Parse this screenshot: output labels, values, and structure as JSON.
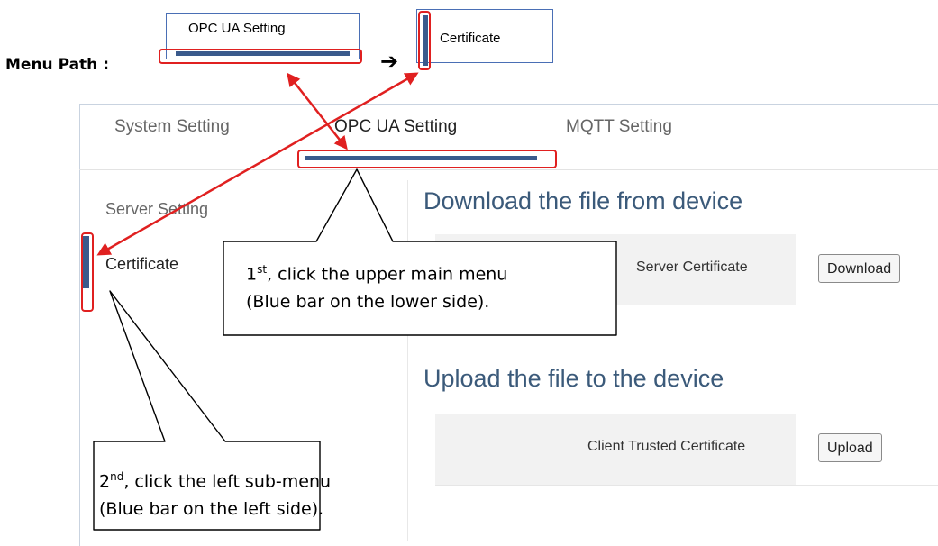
{
  "menu_path": {
    "label": "Menu Path :",
    "step1_label": "OPC UA Setting",
    "arrow": "➔",
    "step2_label": "Certificate"
  },
  "top_nav": {
    "tabs": [
      {
        "label": "System Setting",
        "active": false
      },
      {
        "label": "OPC UA Setting",
        "active": true
      },
      {
        "label": "MQTT Setting",
        "active": false
      }
    ]
  },
  "sidebar": {
    "items": [
      {
        "label": "Server Setting",
        "active": false
      },
      {
        "label": "Certificate",
        "active": true
      }
    ]
  },
  "download_section": {
    "title": "Download the file from device",
    "row_label": "Server Certificate",
    "button": "Download"
  },
  "upload_section": {
    "title": "Upload the file to the device",
    "row_label": "Client Trusted Certificate",
    "button": "Upload"
  },
  "callouts": {
    "first": {
      "ordinal": "1",
      "sup": "st",
      "line1": ", click the upper main menu",
      "line2": "(Blue bar on the lower side)."
    },
    "second": {
      "ordinal": "2",
      "sup": "nd",
      "line1": ", click the left sub-menu",
      "line2": "(Blue bar on the left side)."
    }
  },
  "colors": {
    "active_bar": "#3a5a8c",
    "highlight": "#e02020",
    "section_title": "#3b5a7a"
  }
}
